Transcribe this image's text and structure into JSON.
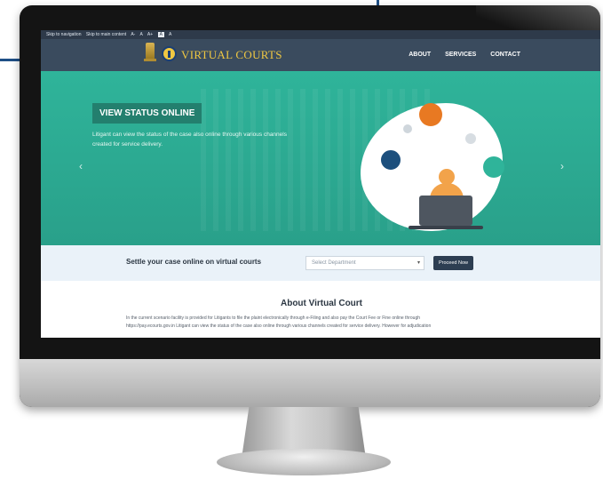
{
  "accessibility_bar": {
    "skip_navigation": "Skip to navigation",
    "skip_content": "Skip to main content",
    "font_sizes": [
      "A-",
      "A",
      "A+",
      "A",
      "A"
    ]
  },
  "header": {
    "logo_text": "VIRTUAL COURTS",
    "nav": [
      "ABOUT",
      "SERVICES",
      "CONTACT"
    ]
  },
  "hero": {
    "title": "VIEW STATUS ONLINE",
    "description": "Litigant can view the status of the case also online through various channels created for service delivery."
  },
  "settle": {
    "label": "Settle your case online on virtual courts",
    "select_placeholder": "Select Department",
    "button": "Proceed Now"
  },
  "about": {
    "title": "About Virtual Court",
    "text_line1": "In the current scenario facility is provided for Litigants to file the plaint electronically through e-Filing and also pay the Court Fee or Fine online through",
    "text_line2": "https://pay.ecourts.gov.in Litigant can view the status of the case also online through various channels created for service delivery. However for adjudication"
  },
  "colors": {
    "hero_bg": "#2fb49a",
    "nav_bg": "#3a4b5e",
    "logo_gold": "#f0c842",
    "button_bg": "#2d3e52"
  }
}
